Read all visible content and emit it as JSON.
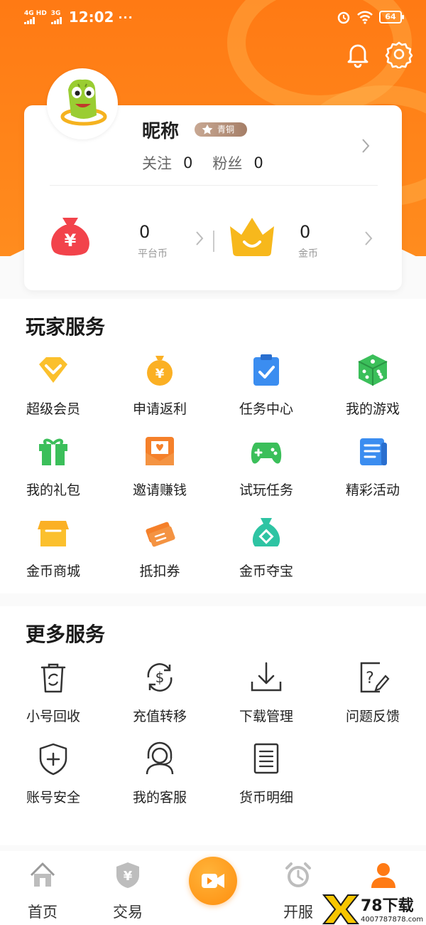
{
  "status_bar": {
    "signal_1_label": "4G HD",
    "signal_2_label": "3G",
    "time": "12:02",
    "dots": "···",
    "battery": "64"
  },
  "header": {
    "icons": [
      "bell-icon",
      "gear-icon"
    ]
  },
  "profile": {
    "nickname": "昵称",
    "level_badge": "青铜",
    "follow_label": "关注",
    "follow_count": "0",
    "fans_label": "粉丝",
    "fans_count": "0"
  },
  "wallet": {
    "platform_coin_amount": "0",
    "platform_coin_label": "平台币",
    "gold_amount": "0",
    "gold_label": "金币"
  },
  "player_services": {
    "title": "玩家服务",
    "items": [
      {
        "label": "超级会员",
        "icon": "diamond-icon"
      },
      {
        "label": "申请返利",
        "icon": "coin-bag-icon"
      },
      {
        "label": "任务中心",
        "icon": "clipboard-check-icon"
      },
      {
        "label": "我的游戏",
        "icon": "dice-icon"
      },
      {
        "label": "我的礼包",
        "icon": "gift-icon"
      },
      {
        "label": "邀请赚钱",
        "icon": "envelope-heart-icon"
      },
      {
        "label": "试玩任务",
        "icon": "gamepad-icon"
      },
      {
        "label": "精彩活动",
        "icon": "news-icon"
      },
      {
        "label": "金币商城",
        "icon": "store-icon"
      },
      {
        "label": "抵扣券",
        "icon": "ticket-icon"
      },
      {
        "label": "金币夺宝",
        "icon": "treasure-bag-icon"
      }
    ]
  },
  "more_services": {
    "title": "更多服务",
    "items": [
      {
        "label": "小号回收",
        "icon": "recycle-bin-icon"
      },
      {
        "label": "充值转移",
        "icon": "dollar-exchange-icon"
      },
      {
        "label": "下载管理",
        "icon": "download-icon"
      },
      {
        "label": "问题反馈",
        "icon": "question-edit-icon"
      },
      {
        "label": "账号安全",
        "icon": "shield-plus-icon"
      },
      {
        "label": "我的客服",
        "icon": "headset-icon"
      },
      {
        "label": "货币明细",
        "icon": "list-document-icon"
      }
    ]
  },
  "bottom_nav": {
    "items": [
      {
        "label": "首页",
        "icon": "home-icon"
      },
      {
        "label": "交易",
        "icon": "yen-shield-icon"
      },
      {
        "label": "",
        "icon": "video-camera-icon"
      },
      {
        "label": "开服",
        "icon": "alarm-clock-icon"
      },
      {
        "label": "",
        "icon": "user-icon"
      }
    ],
    "active_color": "#ff7a14"
  },
  "colors": {
    "brand_orange": "#ff7a14",
    "coin_red": "#f2434b",
    "crown_yellow": "#f7b81c"
  },
  "watermark": {
    "brand": "78下载",
    "site": "4007787878.com"
  }
}
